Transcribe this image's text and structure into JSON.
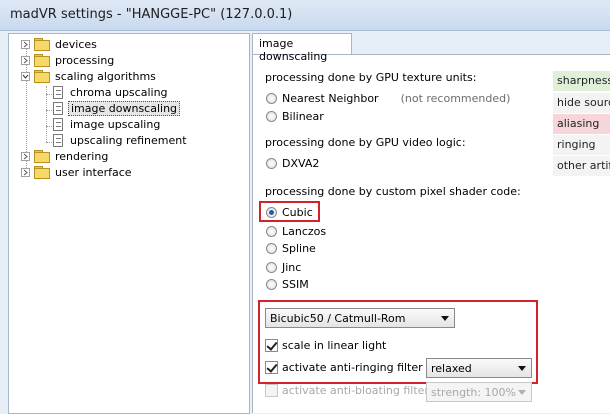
{
  "window": {
    "title": "madVR settings - \"HANGGE-PC\" (127.0.0.1)"
  },
  "tree": {
    "devices": "devices",
    "processing": "processing",
    "scaling": "scaling algorithms",
    "chroma": "chroma upscaling",
    "downscaling": "image downscaling",
    "upscaling": "image upscaling",
    "refinement": "upscaling refinement",
    "rendering": "rendering",
    "ui": "user interface"
  },
  "tab": {
    "label": "image downscaling"
  },
  "sections": {
    "gpu_texture": "processing done by GPU texture units:",
    "gpu_video": "processing done by GPU video logic:",
    "pixel_shader": "processing done by custom pixel shader code:"
  },
  "radios": {
    "nearest": "Nearest Neighbor",
    "nearest_note": "(not recommended)",
    "bilinear": "Bilinear",
    "dxva2": "DXVA2",
    "cubic": "Cubic",
    "lanczos": "Lanczos",
    "spline": "Spline",
    "jinc": "Jinc",
    "ssim": "SSIM",
    "selected": "Cubic"
  },
  "cubic_options": {
    "variant": "Bicubic50 / Catmull-Rom",
    "linear_light": "scale in linear light",
    "linear_light_checked": true,
    "anti_ringing": "activate anti-ringing filter",
    "anti_ringing_checked": true,
    "anti_ringing_mode": "relaxed",
    "anti_bloating": "activate anti-bloating filter",
    "anti_bloating_checked": false,
    "strength": "strength: 100%"
  },
  "legend": {
    "sharpness": "sharpness",
    "hide_source": "hide source",
    "aliasing": "aliasing",
    "ringing": "ringing",
    "other": "other artifa"
  },
  "colors": {
    "sharpness": "#dff0d8",
    "aliasing": "#f6d6d8",
    "neutral": "#f3f3f3",
    "highlight": "#d2232a"
  }
}
